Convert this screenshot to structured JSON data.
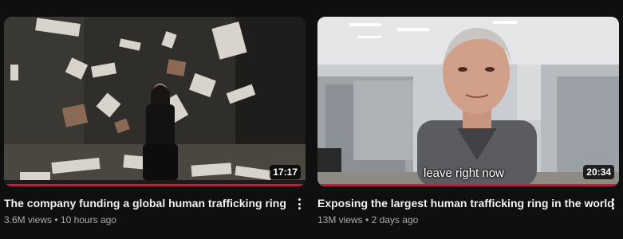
{
  "videos": [
    {
      "title": "The company funding a global human trafficking ring",
      "views": "3.6M views",
      "age": "10 hours ago",
      "separator": "•",
      "duration": "17:17",
      "progress_fraction": 1.0,
      "caption": ""
    },
    {
      "title": "Exposing the largest human trafficking ring in the world",
      "views": "13M views",
      "age": "2 days ago",
      "separator": "•",
      "duration": "20:34",
      "progress_fraction": 1.0,
      "caption": "leave right now"
    }
  ],
  "icons": {
    "more": "more-vert-icon"
  },
  "colors": {
    "background": "#0f0f0f",
    "progress": "#ff0033",
    "title": "#f1f1f1",
    "meta": "#aaaaaa"
  }
}
